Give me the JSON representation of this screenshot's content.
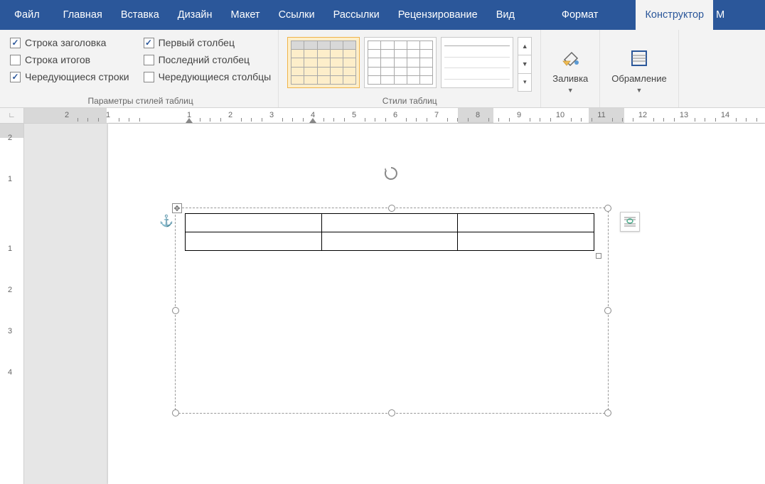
{
  "tabs": {
    "file": "Файл",
    "home": "Главная",
    "insert": "Вставка",
    "design": "Дизайн",
    "layout": "Макет",
    "references": "Ссылки",
    "mailings": "Рассылки",
    "review": "Рецензирование",
    "view": "Вид",
    "format": "Формат",
    "constructor": "Конструктор",
    "m": "М"
  },
  "options": {
    "header_row": "Строка заголовка",
    "total_row": "Строка итогов",
    "banded_rows": "Чередующиеся строки",
    "first_col": "Первый столбец",
    "last_col": "Последний столбец",
    "banded_cols": "Чередующиеся столбцы",
    "group_label": "Параметры стилей таблиц"
  },
  "checks": {
    "header_row": true,
    "total_row": false,
    "banded_rows": true,
    "first_col": true,
    "last_col": false,
    "banded_cols": false
  },
  "styles": {
    "group_label": "Стили таблиц"
  },
  "shading": {
    "label": "Заливка"
  },
  "borders": {
    "label": "Обрамление"
  },
  "ruler_h": {
    "numbers": [
      2,
      1,
      1,
      2,
      3,
      4,
      5,
      6,
      7,
      8,
      9,
      10,
      11,
      12,
      13,
      14
    ]
  },
  "ruler_v": {
    "numbers": [
      2,
      1,
      1,
      2,
      3,
      4
    ]
  },
  "doc": {
    "table": {
      "rows": 2,
      "cols": 3
    }
  }
}
